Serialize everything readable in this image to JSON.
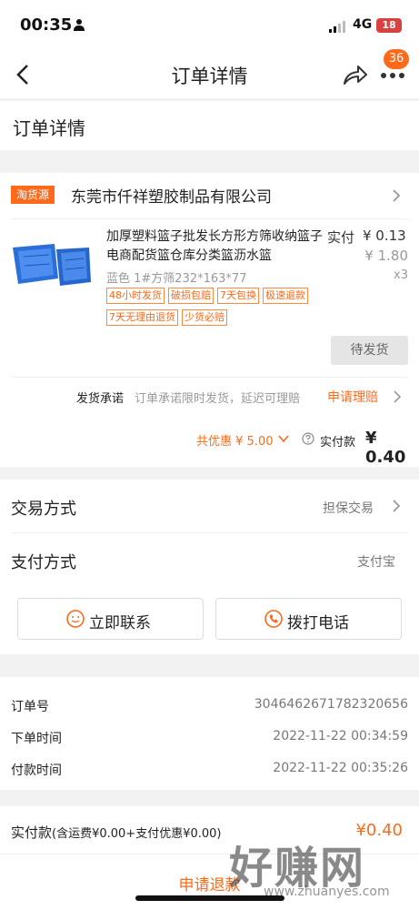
{
  "status_bar": {
    "time": "00:35",
    "network": "4G",
    "battery": "18"
  },
  "nav": {
    "title": "订单详情",
    "badge": "36"
  },
  "section": {
    "title": "订单详情"
  },
  "shop": {
    "tag": "淘货源",
    "name": "东莞市仟祥塑胶制品有限公司"
  },
  "product": {
    "title": "加厚塑料篮子批发长方形方筛收纳篮子电商配货篮仓库分类篮沥水篮",
    "price_label": "实付",
    "price": "¥ 0.13",
    "original_price": "¥ 1.80",
    "sku": "蓝色 1#方筛232*163*77",
    "quantity": "x3",
    "tags_row1": [
      "48小时发货",
      "破损包赔",
      "7天包换",
      "极速退款"
    ],
    "tags_row2": [
      "7天无理由退货",
      "少货必赔"
    ],
    "status_button": "待发货"
  },
  "promise": {
    "label": "发货承诺",
    "text": "订单承诺限时发货，延迟可理赔",
    "link": "申请理赔"
  },
  "summary": {
    "discount": "共优惠 ¥ 5.00",
    "paid_label": "实付款",
    "paid_value": "¥ 0.40"
  },
  "payment": {
    "trade_label": "交易方式",
    "trade_value": "担保交易",
    "pay_label": "支付方式",
    "pay_value": "支付宝",
    "contact_button": "立即联系",
    "call_button": "拨打电话"
  },
  "info": {
    "order_no_label": "订单号",
    "order_no": "3046462671782320656",
    "order_time_label": "下单时间",
    "order_time": "2022-11-22 00:34:59",
    "pay_time_label": "付款时间",
    "pay_time": "2022-11-22 00:35:26"
  },
  "total": {
    "label": "实付款",
    "note": "(含运费¥0.00+支付优惠¥0.00)",
    "value": "¥0.40",
    "refund_button": "申请退款"
  },
  "watermark": {
    "big": "好赚网",
    "small": "www.zhuanyes.com"
  },
  "colors": {
    "accent": "#ff6a1a",
    "background": "#f2f2f2",
    "badge": "#ff6a1a",
    "product_blue": "#2d6fd8"
  },
  "icons": [
    "person-icon",
    "signal-icon",
    "back-arrow-icon",
    "share-icon",
    "more-icon",
    "chevron-right-icon",
    "chevron-down-icon",
    "question-icon",
    "chat-smile-icon",
    "phone-icon"
  ]
}
